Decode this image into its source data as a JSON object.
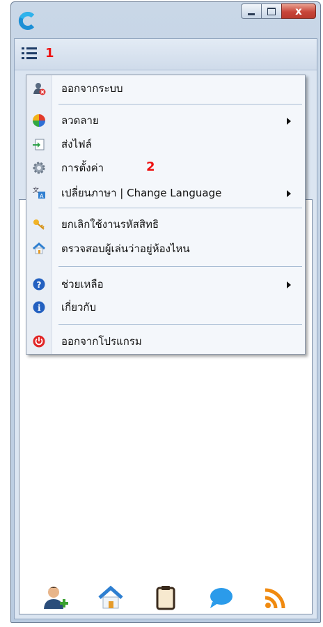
{
  "window": {
    "close_glyph": "x",
    "app_logo": "c-logo-icon"
  },
  "toolbar": {
    "menu_icon": "menu-list-icon",
    "annotation_1": "1"
  },
  "menu": {
    "items": [
      {
        "label": "ออกจากระบบ",
        "icon": "user-logout-icon",
        "submenu": false
      },
      {
        "label": "ลวดลาย",
        "icon": "color-palette-icon",
        "submenu": true
      },
      {
        "label": "ส่งไฟล์",
        "icon": "send-file-icon",
        "submenu": false
      },
      {
        "label": "การตั้งค่า",
        "icon": "gear-icon",
        "submenu": false
      },
      {
        "label": "เปลี่ยนภาษา | Change Language",
        "icon": "language-icon",
        "submenu": true
      },
      {
        "label": "ยกเลิกใช้งานรหัสสิทธิ",
        "icon": "key-icon",
        "submenu": false
      },
      {
        "label": "ตรวจสอบผู้เล่นว่าอยู่ห้องไหน",
        "icon": "house-search-icon",
        "submenu": false
      },
      {
        "label": "ช่วยเหลือ",
        "icon": "help-icon",
        "submenu": true
      },
      {
        "label": "เกี่ยวกับ",
        "icon": "info-icon",
        "submenu": false
      },
      {
        "label": "ออกจากโปรแกรม",
        "icon": "power-icon",
        "submenu": false
      }
    ],
    "annotation_2": "2"
  },
  "bottom_bar": {
    "icons": [
      "add-user-icon",
      "home-icon",
      "clipboard-icon",
      "chat-icon",
      "rss-icon"
    ]
  },
  "colors": {
    "accent": "#1f5fa8",
    "annotation": "#e11111"
  }
}
